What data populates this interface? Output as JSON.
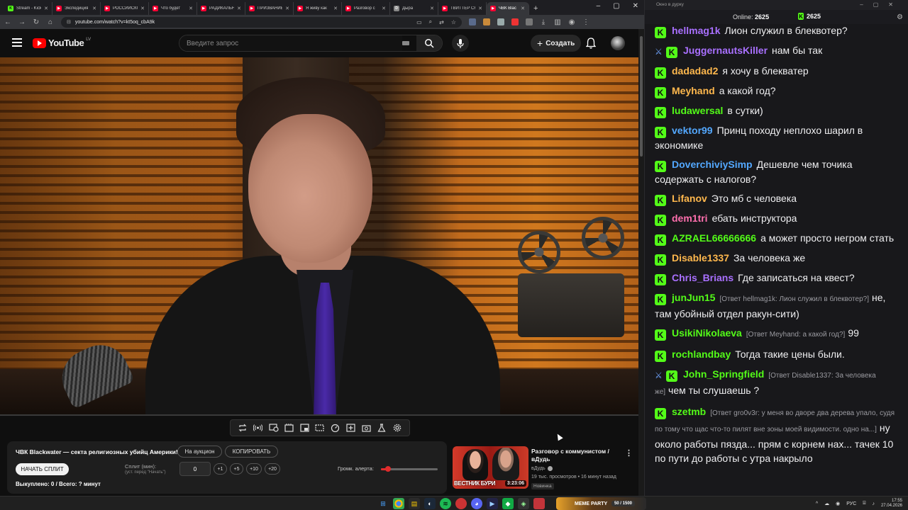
{
  "browser": {
    "tabs": [
      {
        "label": "Stream - Kick",
        "icon": "kick"
      },
      {
        "label": "Экспедиция",
        "icon": "yt"
      },
      {
        "label": "РОССИЙСКО",
        "icon": "yt"
      },
      {
        "label": "Что будет",
        "icon": "yt"
      },
      {
        "label": "РАДИКАЛЬН",
        "icon": "yt"
      },
      {
        "label": "ПРИЗВАНИЕ",
        "icon": "yt"
      },
      {
        "label": "Я живу как",
        "icon": "yt"
      },
      {
        "label": "Разговор с",
        "icon": "yt"
      },
      {
        "label": "Дыра",
        "icon": "dy"
      },
      {
        "label": "ТВИТТЕР СН",
        "icon": "yt"
      },
      {
        "label": "ЧВК Blac",
        "icon": "yt",
        "active": true
      }
    ],
    "url": "youtube.com/watch?v=kt5oq_cbA9k"
  },
  "youtube": {
    "logo_text": "YouTube",
    "region": "LV",
    "search_placeholder": "Введите запрос",
    "create_label": "Создать",
    "video_progress": 0
  },
  "auction": {
    "video_title": "ЧВК Blackwater — секта религиозных убийц Америки!",
    "auction_label": "На аукцион",
    "copy_label": "КОПИРОВАТЬ",
    "start_split_label": "НАЧАТЬ СПЛИТ",
    "split_label": "Сплит (мин):",
    "split_hint": "(уст. перед \"Начать\")",
    "split_value": "0",
    "increments": [
      "+1",
      "+5",
      "+10",
      "+20"
    ],
    "volume_label": "Громк. алерта:",
    "volume_level": 0.12,
    "bought_text": "Выкуплено: 0 / Всего: ? минут"
  },
  "recommended": {
    "title": "Разговор с коммунистом / вДудь",
    "channel": "вДудь",
    "meta": "19 тыс. просмотров • 16 минут назад",
    "badge": "Новинка",
    "duration": "3:23:06",
    "thumb_text": "ВЕСТНИК БУРИ"
  },
  "chat": {
    "window_title": "Окно в дурку",
    "online_label": "Online:",
    "online_count": "2625",
    "kick_count": "2625",
    "messages": [
      {
        "user": "hellmag1k",
        "color": "#a970ff",
        "text": "Лион служил в блеквотер?"
      },
      {
        "user": "JuggernautsKiller",
        "color": "#a970ff",
        "text": "нам бы так",
        "sword": true
      },
      {
        "user": "dadadad2",
        "color": "#ffb84d",
        "text": "я хочу в блекватер"
      },
      {
        "user": "Meyhand",
        "color": "#ffb84d",
        "text": "а какой год?"
      },
      {
        "user": "ludawersal",
        "color": "#53fc18",
        "text": "в сутки)"
      },
      {
        "user": "vektor99",
        "color": "#53a8ff",
        "text": "Принц походу неплохо шарил в экономике"
      },
      {
        "user": "DoverchiviySimp",
        "color": "#53a8ff",
        "text": "Дешевле чем точика содержать с налогов?"
      },
      {
        "user": "Lifanov",
        "color": "#ffb84d",
        "text": "Это мб с человека"
      },
      {
        "user": "dem1tri",
        "color": "#ff6fae",
        "text": "ебать инструктора"
      },
      {
        "user": "AZRAEL66666666",
        "color": "#53fc18",
        "text": "а может просто негром стать"
      },
      {
        "user": "Disable1337",
        "color": "#ffb84d",
        "text": "За человека же"
      },
      {
        "user": "Chris_Brians",
        "color": "#a970ff",
        "text": "Где записаться на квест?"
      },
      {
        "user": "junJun15",
        "color": "#53fc18",
        "reply": "[Ответ hellmag1k: Лион служил в блеквотер?]",
        "text": "не, там убойный отдел ракун-сити)"
      },
      {
        "user": "UsikiNikolaeva",
        "color": "#53fc18",
        "reply": "[Ответ Meyhand: а какой год?]",
        "text": "99"
      },
      {
        "user": "rochlandbay",
        "color": "#53fc18",
        "text": "Тогда такие цены были."
      },
      {
        "user": "John_Springfield",
        "color": "#53fc18",
        "reply": "[Ответ Disable1337: За человека же]",
        "text": "чем ты слушаешь ?",
        "sword": true
      },
      {
        "user": "szetmb",
        "color": "#53fc18",
        "reply": "[Ответ gro0v3r: у меня во дворе два дерева упало, судя по тому что щас что-то пилят вне зоны моей видимости. одно на...]",
        "text": "ну около работы пязда... прям с корнем нах... тачек 10 по пути до работы с утра накрыло"
      }
    ]
  },
  "taskbar": {
    "widget_label": "MEME PARTY",
    "widget_count": "50 / 1500",
    "lang": "РУС",
    "time": "17:55",
    "date": "27.04.2026"
  }
}
